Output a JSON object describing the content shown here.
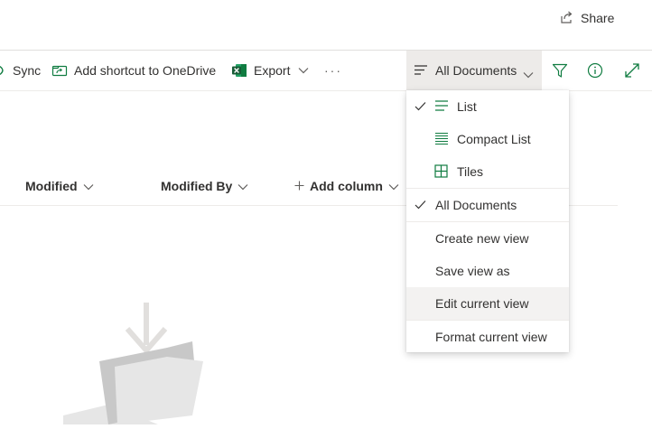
{
  "header": {
    "share_label": "Share"
  },
  "commandbar": {
    "sync_label": "Sync",
    "add_shortcut_label": "Add shortcut to OneDrive",
    "export_label": "Export",
    "more_label": "···",
    "view_label": "All Documents"
  },
  "columns": [
    {
      "label": "Modified"
    },
    {
      "label": "Modified By"
    },
    {
      "label": "Add column"
    }
  ],
  "view_menu": {
    "items": [
      {
        "label": "List",
        "checked": true,
        "icon": "list-icon"
      },
      {
        "label": "Compact List",
        "checked": false,
        "icon": "compact-list-icon"
      },
      {
        "label": "Tiles",
        "checked": false,
        "icon": "tiles-icon"
      },
      {
        "label": "All Documents",
        "checked": true
      },
      {
        "label": "Create new view"
      },
      {
        "label": "Save view as"
      },
      {
        "label": "Edit current view",
        "hovered": true
      },
      {
        "label": "Format current view"
      }
    ]
  },
  "colors": {
    "accent": "#107c41",
    "excel": "#185c37",
    "hover": "#f3f2f1",
    "selected_bg": "#edebe9"
  }
}
